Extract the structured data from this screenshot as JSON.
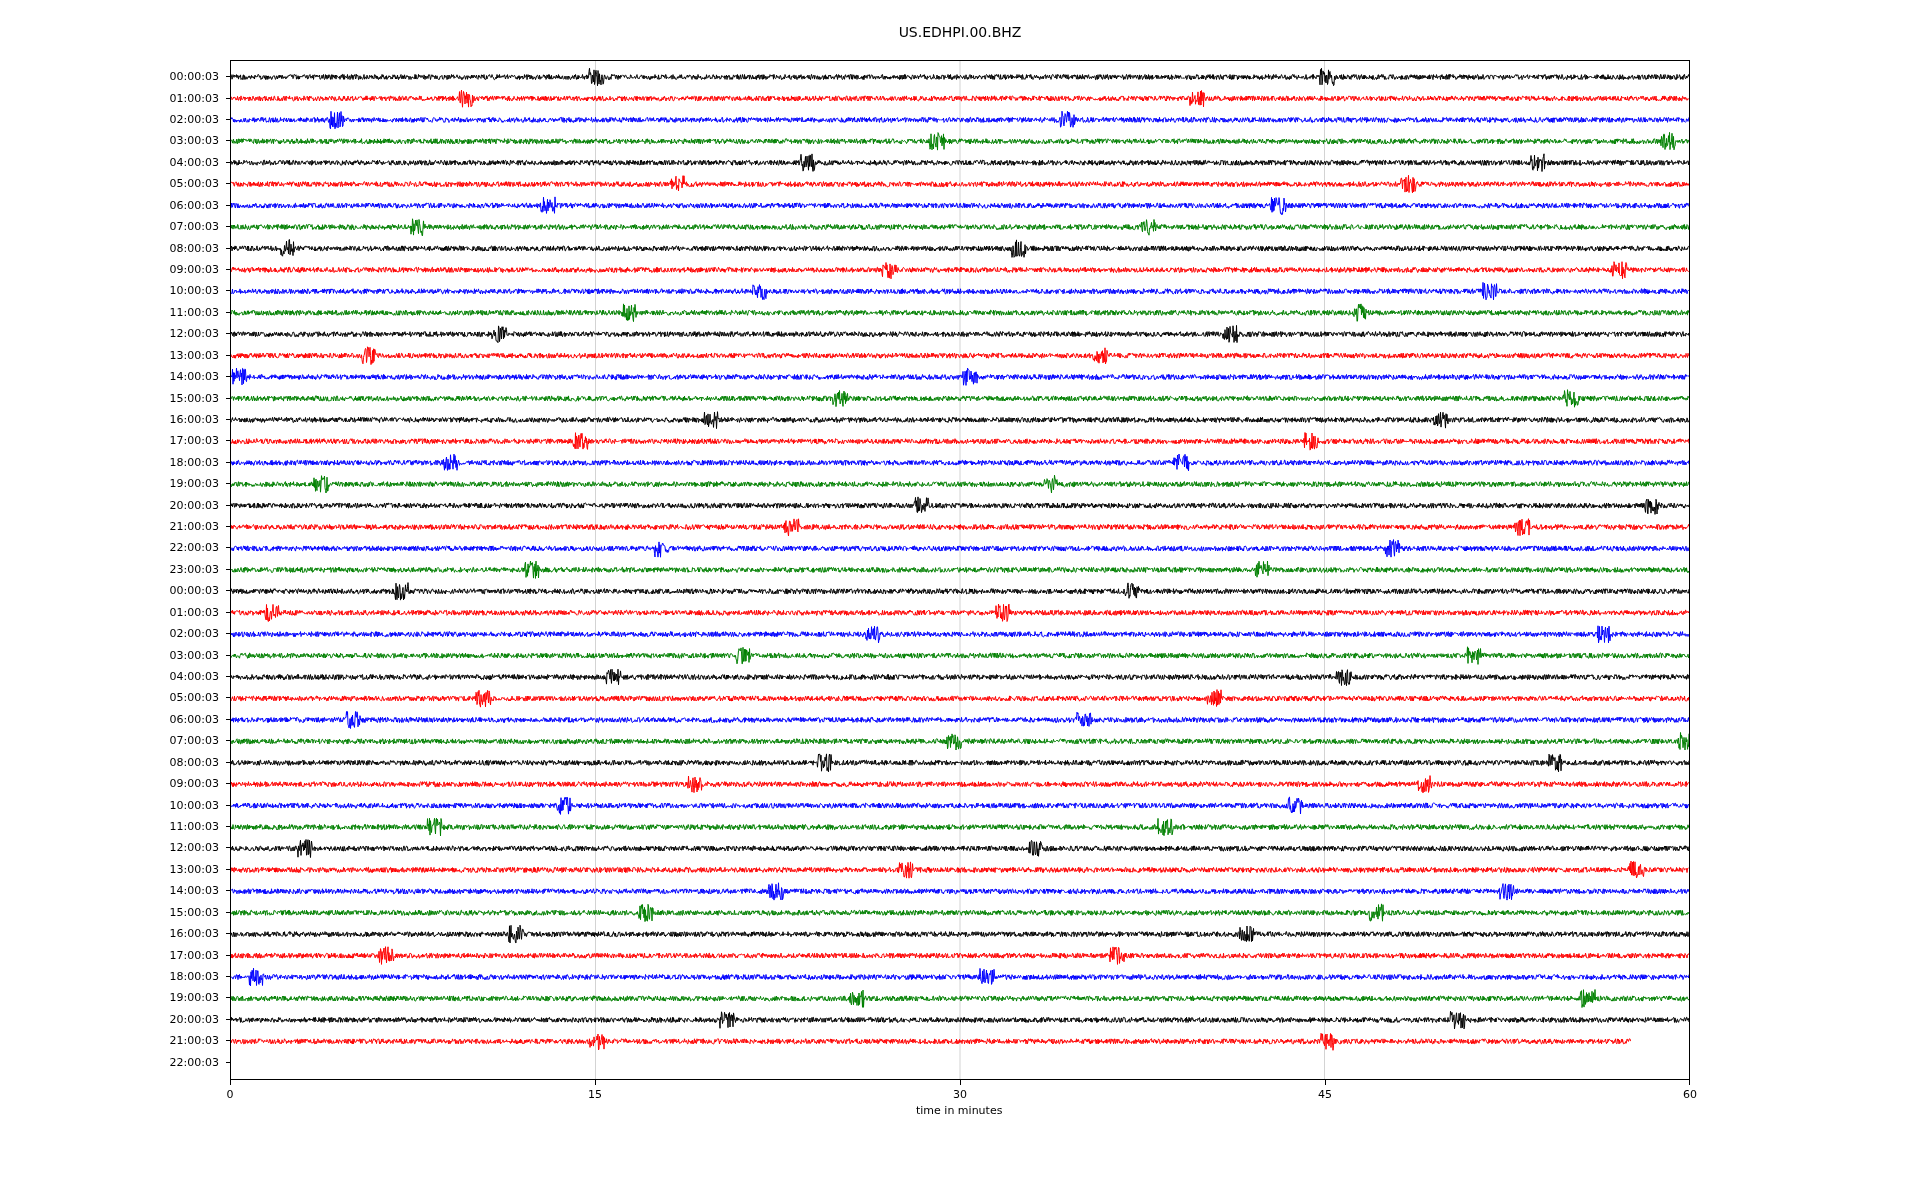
{
  "title": "US.EDHPI.00.BHZ",
  "rows": [
    {
      "label": "00:00:03",
      "color": "#000000",
      "level": 1
    },
    {
      "label": "01:00:03",
      "color": "#ff0000",
      "level": 1
    },
    {
      "label": "02:00:03",
      "color": "#0000ff",
      "level": 1
    },
    {
      "label": "03:00:03",
      "color": "#008000",
      "level": 1
    },
    {
      "label": "04:00:03",
      "color": "#000000",
      "level": 1
    },
    {
      "label": "05:00:03",
      "color": "#ff0000",
      "level": 1
    },
    {
      "label": "06:00:03",
      "color": "#0000ff",
      "level": 1
    },
    {
      "label": "07:00:03",
      "color": "#008000",
      "level": 1
    },
    {
      "label": "08:00:03",
      "color": "#000000",
      "level": 1
    },
    {
      "label": "09:00:03",
      "color": "#ff0000",
      "level": 1
    },
    {
      "label": "10:00:03",
      "color": "#0000ff",
      "level": 1
    },
    {
      "label": "11:00:03",
      "color": "#008000",
      "level": 1
    },
    {
      "label": "12:00:03",
      "color": "#000000",
      "level": 1
    },
    {
      "label": "13:00:03",
      "color": "#ff0000",
      "level": 1
    },
    {
      "label": "14:00:03",
      "color": "#0000ff",
      "level": 1
    },
    {
      "label": "15:00:03",
      "color": "#008000",
      "level": 1
    },
    {
      "label": "16:00:03",
      "color": "#000000",
      "level": 1
    },
    {
      "label": "17:00:03",
      "color": "#ff0000",
      "level": 1
    },
    {
      "label": "18:00:03",
      "color": "#0000ff",
      "level": 1
    },
    {
      "label": "19:00:03",
      "color": "#008000",
      "level": 1
    },
    {
      "label": "20:00:03",
      "color": "#000000",
      "level": 1
    },
    {
      "label": "21:00:03",
      "color": "#ff0000",
      "level": 1
    },
    {
      "label": "22:00:03",
      "color": "#0000ff",
      "level": 1
    },
    {
      "label": "23:00:03",
      "color": "#008000",
      "level": 1
    },
    {
      "label": "00:00:03",
      "color": "#000000",
      "level": 1
    },
    {
      "label": "01:00:03",
      "color": "#ff0000",
      "level": 1
    },
    {
      "label": "02:00:03",
      "color": "#0000ff",
      "level": 1
    },
    {
      "label": "03:00:03",
      "color": "#008000",
      "level": 1
    },
    {
      "label": "04:00:03",
      "color": "#000000",
      "level": 1
    },
    {
      "label": "05:00:03",
      "color": "#ff0000",
      "level": 1
    },
    {
      "label": "06:00:03",
      "color": "#0000ff",
      "level": 1
    },
    {
      "label": "07:00:03",
      "color": "#008000",
      "level": 1
    },
    {
      "label": "08:00:03",
      "color": "#000000",
      "level": 1
    },
    {
      "label": "09:00:03",
      "color": "#ff0000",
      "level": 1
    },
    {
      "label": "10:00:03",
      "color": "#0000ff",
      "level": 1
    },
    {
      "label": "11:00:03",
      "color": "#008000",
      "level": 1
    },
    {
      "label": "12:00:03",
      "color": "#000000",
      "level": 1
    },
    {
      "label": "13:00:03",
      "color": "#ff0000",
      "level": 1
    },
    {
      "label": "14:00:03",
      "color": "#0000ff",
      "level": 1
    },
    {
      "label": "15:00:03",
      "color": "#008000",
      "level": 1
    },
    {
      "label": "16:00:03",
      "color": "#000000",
      "level": 1
    },
    {
      "label": "17:00:03",
      "color": "#ff0000",
      "level": 1
    },
    {
      "label": "18:00:03",
      "color": "#0000ff",
      "level": 1
    },
    {
      "label": "19:00:03",
      "color": "#008000",
      "level": 1
    },
    {
      "label": "20:00:03",
      "color": "#000000",
      "level": 1
    },
    {
      "label": "21:00:03",
      "color": "#ff0000",
      "level": 0.96
    },
    {
      "label": "22:00:03",
      "level": 0
    }
  ],
  "xticks": [
    "0",
    "15",
    "30",
    "45",
    "60"
  ],
  "xlabel": "time in minutes"
}
